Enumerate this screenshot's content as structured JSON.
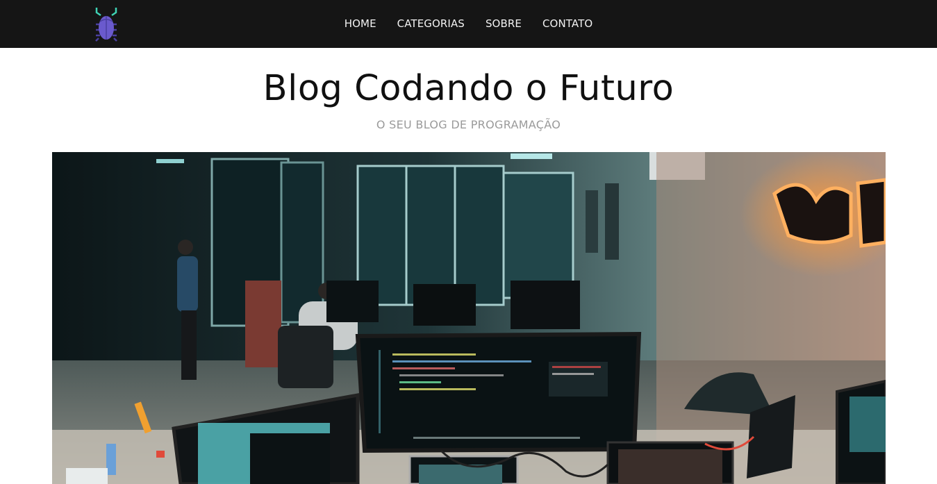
{
  "header": {
    "logo_icon": "bug-icon",
    "nav": [
      {
        "label": "HOME"
      },
      {
        "label": "CATEGORIAS"
      },
      {
        "label": "SOBRE"
      },
      {
        "label": "CONTATO"
      }
    ]
  },
  "main": {
    "title": "Blog Codando o Futuro",
    "subtitle": "O SEU BLOG DE PROGRAMAÇÃO",
    "hero_image_icon": "office-workstation-photo"
  },
  "colors": {
    "topbar": "#151515",
    "logo_body": "#6a5acd",
    "logo_antenna": "#3fd3b5",
    "subtitle": "#9a9a9a"
  }
}
